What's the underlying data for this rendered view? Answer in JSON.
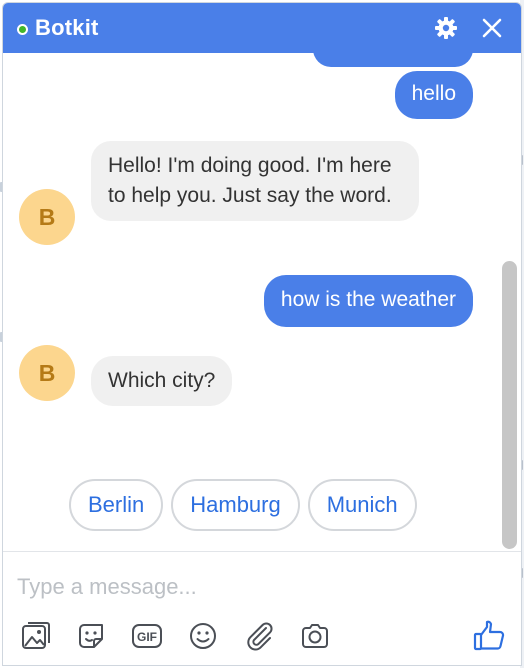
{
  "header": {
    "title": "Botkit",
    "icons": {
      "status": "online-status-dot",
      "settings": "gear-icon",
      "close": "close-icon"
    }
  },
  "messages": [
    {
      "from": "user",
      "text": "hello"
    },
    {
      "from": "bot",
      "avatar_letter": "B",
      "text": "Hello! I'm doing good. I'm here to help you. Just say the word."
    },
    {
      "from": "user",
      "text": "how is the weather"
    },
    {
      "from": "bot",
      "avatar_letter": "B",
      "text": "Which city?"
    }
  ],
  "quick_replies": [
    "Berlin",
    "Hamburg",
    "Munich"
  ],
  "composer": {
    "placeholder": "Type a message...",
    "tools": [
      "image-icon",
      "sticker-icon",
      "gif-icon",
      "emoji-icon",
      "attachment-icon",
      "camera-icon"
    ],
    "gif_label": "GIF",
    "like_icon": "thumbs-up-icon"
  },
  "colors": {
    "header": "#4a7fe8",
    "outgoing_bubble": "#4a7fe8",
    "incoming_bubble": "#f0f0f0",
    "avatar": "#fcd68e",
    "status_dot": "#42b72a",
    "quick_reply_text": "#2d6fe0"
  }
}
